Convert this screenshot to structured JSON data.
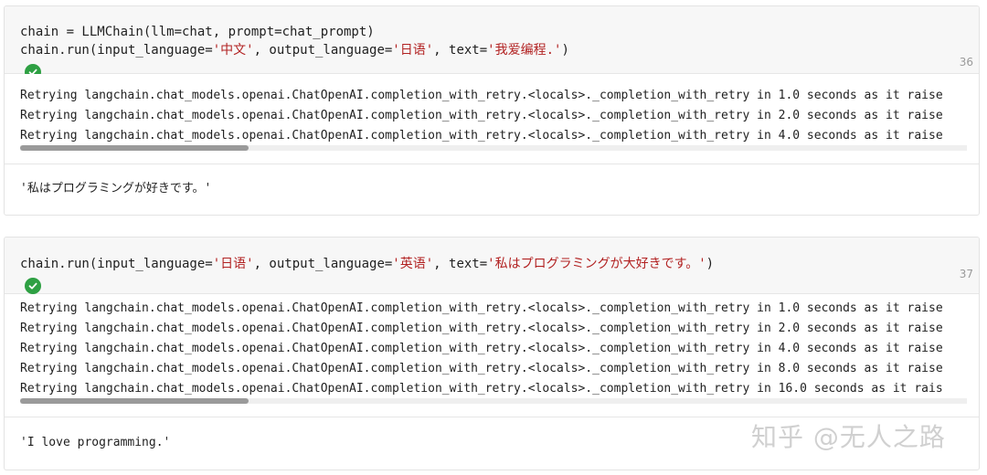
{
  "colors": {
    "string": "#b22222",
    "check": "#2ea043",
    "code_bg": "#f7f7f7"
  },
  "cell1": {
    "code": {
      "line1": "chain = LLMChain(llm=chat, prompt=chat_prompt)",
      "line2_prefix": "chain.run(input_language=",
      "line2_str1": "'中文'",
      "line2_mid1": ", output_language=",
      "line2_str2": "'日语'",
      "line2_mid2": ", text=",
      "line2_str3": "'我爱编程.'",
      "line2_suffix": ")"
    },
    "exec_count": "36",
    "status_icon": "check-circle-icon",
    "log_lines": [
      "Retrying langchain.chat_models.openai.ChatOpenAI.completion_with_retry.<locals>._completion_with_retry in 1.0 seconds as it raise",
      "Retrying langchain.chat_models.openai.ChatOpenAI.completion_with_retry.<locals>._completion_with_retry in 2.0 seconds as it raise",
      "Retrying langchain.chat_models.openai.ChatOpenAI.completion_with_retry.<locals>._completion_with_retry in 4.0 seconds as it raise"
    ],
    "result": "'私はプログラミングが好きです。'"
  },
  "cell2": {
    "code": {
      "line1_prefix": "chain.run(input_language=",
      "line1_str1": "'日语'",
      "line1_mid1": ", output_language=",
      "line1_str2": "'英语'",
      "line1_mid2": ", text=",
      "line1_str3": "'私はプログラミングが大好きです。'",
      "line1_suffix": ")"
    },
    "exec_count": "37",
    "status_icon": "check-circle-icon",
    "log_lines": [
      "Retrying langchain.chat_models.openai.ChatOpenAI.completion_with_retry.<locals>._completion_with_retry in 1.0 seconds as it raise",
      "Retrying langchain.chat_models.openai.ChatOpenAI.completion_with_retry.<locals>._completion_with_retry in 2.0 seconds as it raise",
      "Retrying langchain.chat_models.openai.ChatOpenAI.completion_with_retry.<locals>._completion_with_retry in 4.0 seconds as it raise",
      "Retrying langchain.chat_models.openai.ChatOpenAI.completion_with_retry.<locals>._completion_with_retry in 8.0 seconds as it raise",
      "Retrying langchain.chat_models.openai.ChatOpenAI.completion_with_retry.<locals>._completion_with_retry in 16.0 seconds as it rais"
    ],
    "result": "'I love programming.'"
  },
  "watermark": "知乎 @无人之路"
}
